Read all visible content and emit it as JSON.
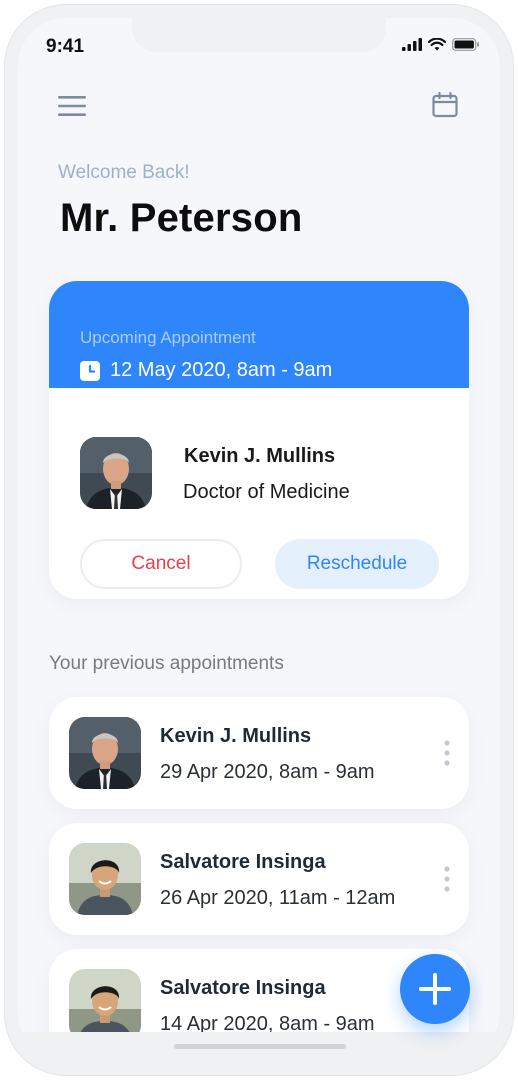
{
  "status_bar": {
    "time": "9:41"
  },
  "header": {
    "menu_icon": "hamburger-menu-icon",
    "calendar_icon": "calendar-icon"
  },
  "greeting": {
    "welcome": "Welcome Back!",
    "name": "Mr. Peterson"
  },
  "upcoming": {
    "label": "Upcoming Appointment",
    "datetime": "12 May 2020, 8am - 9am",
    "doctor_name": "Kevin J. Mullins",
    "doctor_title": "Doctor of Medicine",
    "cancel_label": "Cancel",
    "reschedule_label": "Reschedule"
  },
  "previous": {
    "title": "Your previous appointments",
    "items": [
      {
        "name": "Kevin J. Mullins",
        "datetime": "29 Apr 2020, 8am - 9am"
      },
      {
        "name": "Salvatore Insinga",
        "datetime": "26 Apr 2020, 11am - 12am"
      },
      {
        "name": "Salvatore Insinga",
        "datetime": "14 Apr 2020, 8am - 9am"
      }
    ]
  },
  "colors": {
    "primary": "#2f86fb",
    "cancel": "#ef3b4a",
    "background": "#f6f7fb"
  }
}
